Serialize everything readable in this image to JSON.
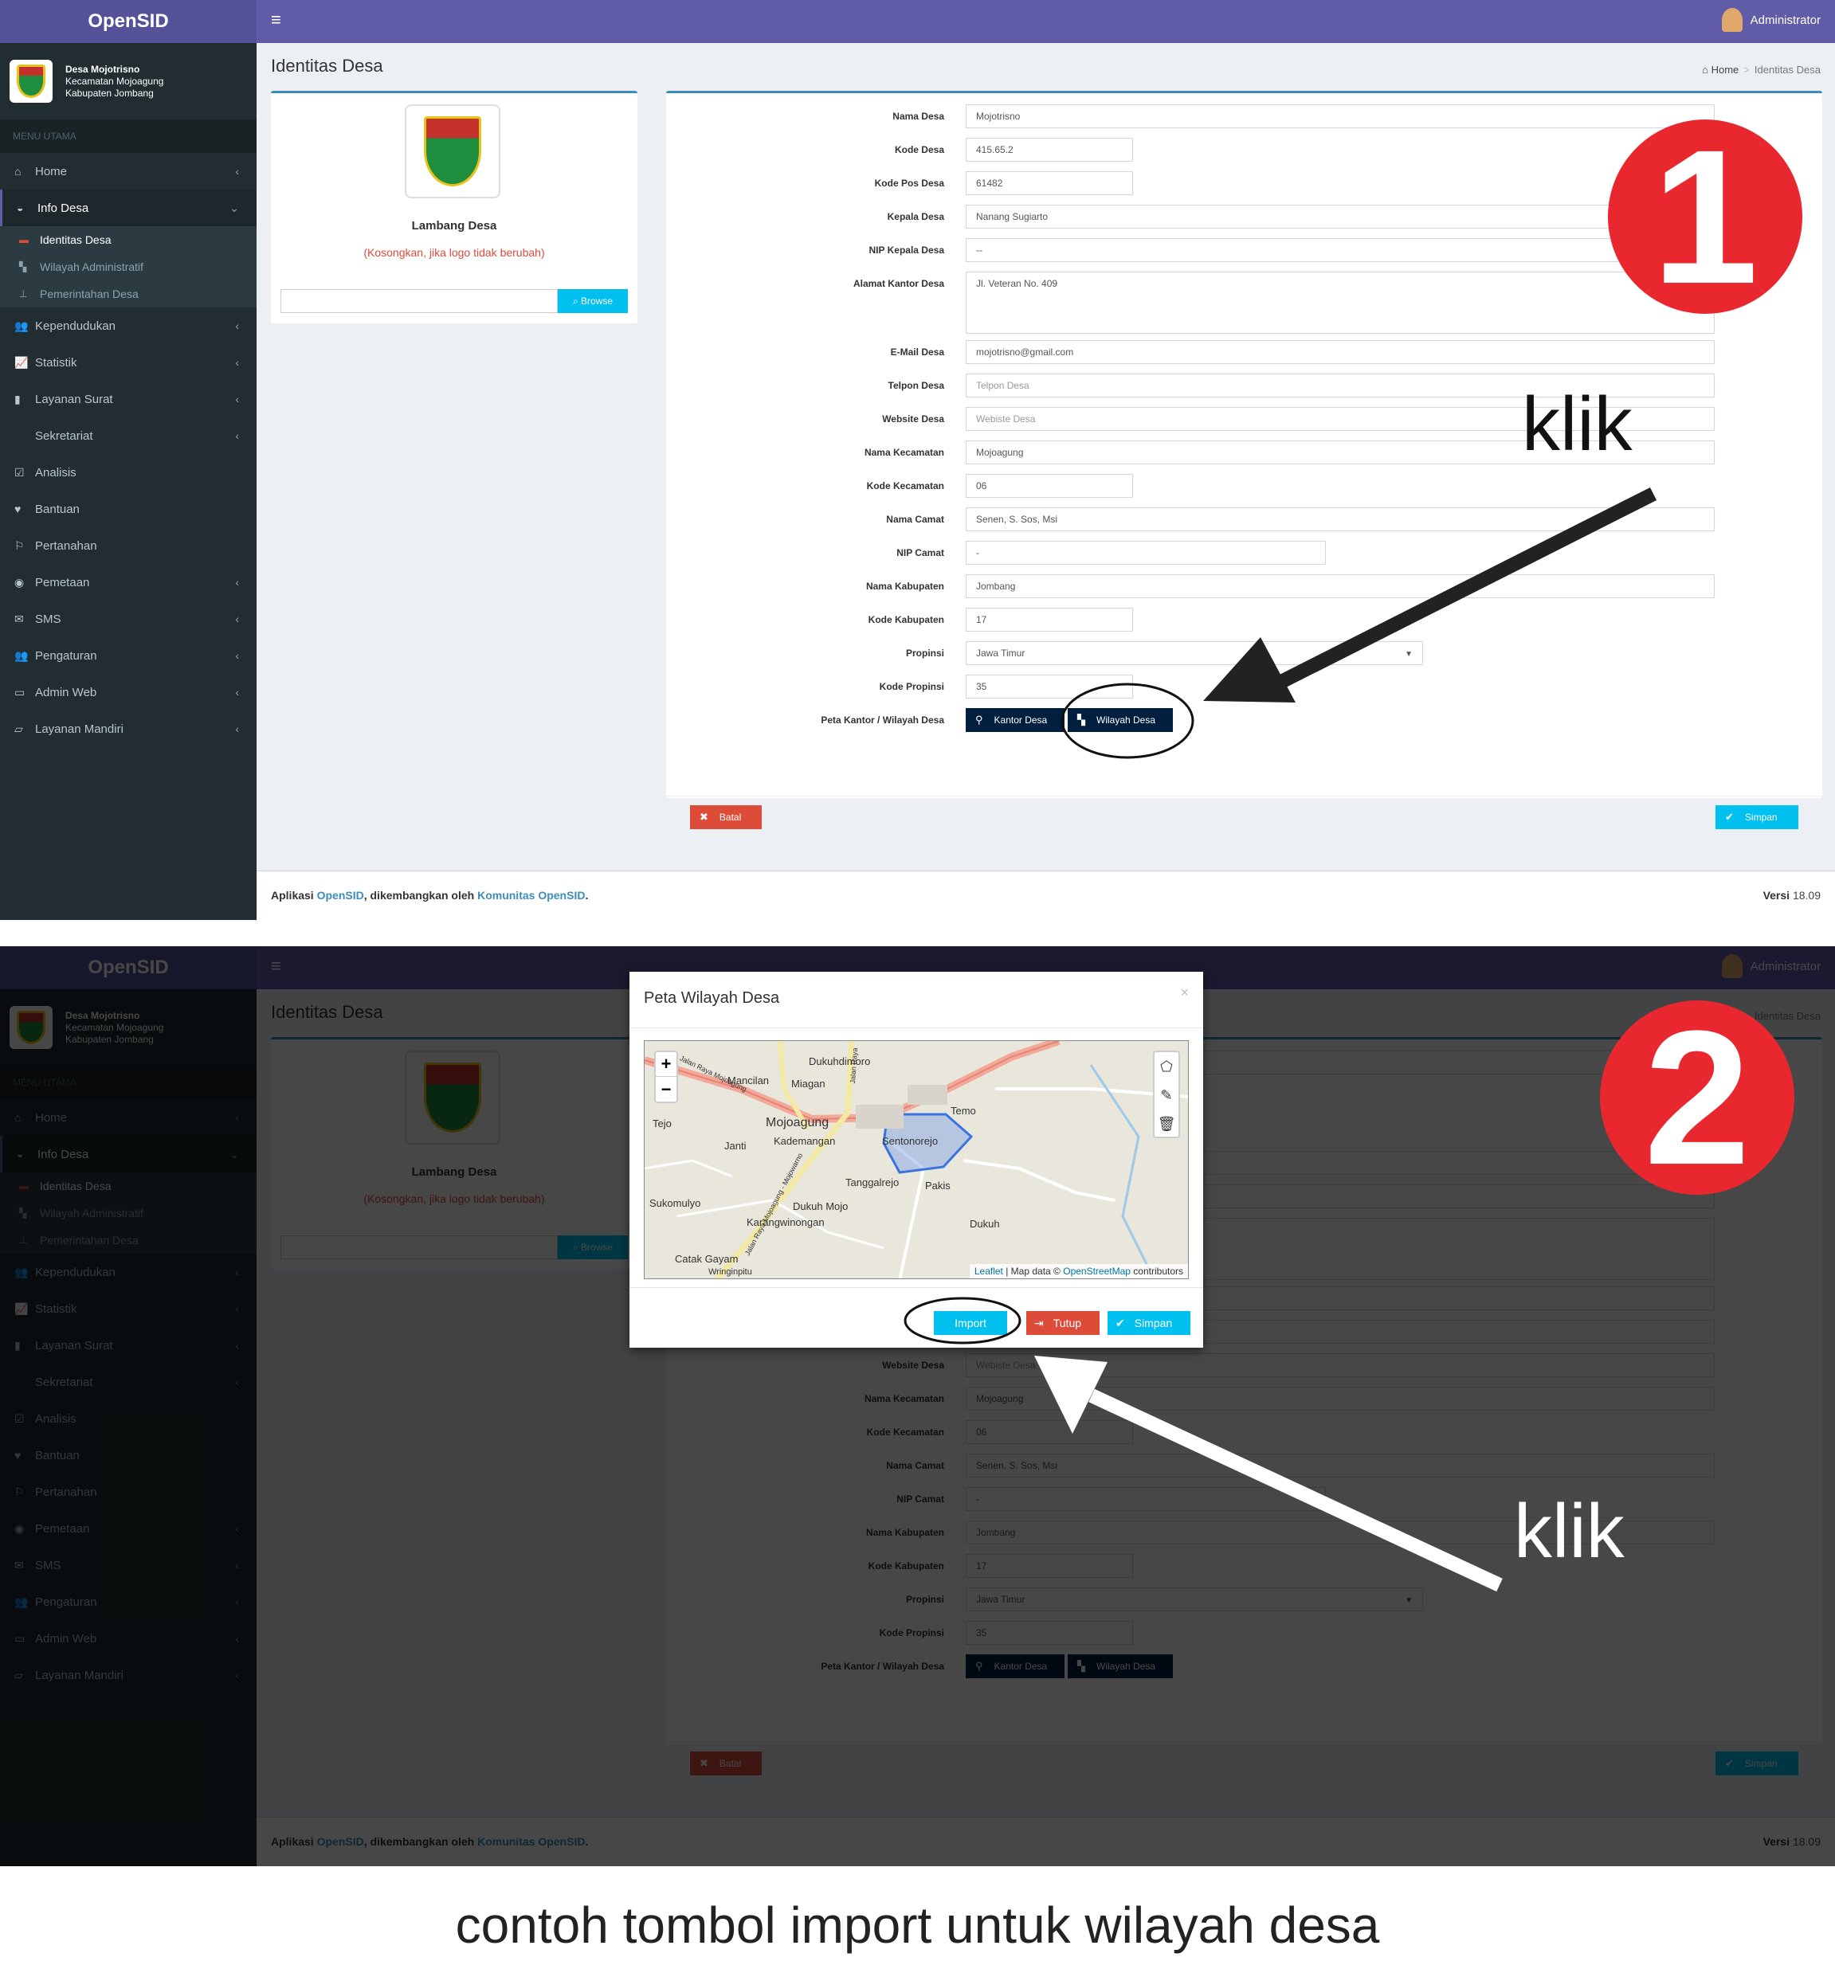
{
  "app": {
    "brand": "OpenSID",
    "user": "Administrator",
    "hamburger": "≡"
  },
  "village": {
    "name": "Desa Mojotrisno",
    "district": "Kecamatan Mojoagung",
    "regency": "Kabupaten Jombang"
  },
  "sidebar": {
    "header": "MENU UTAMA",
    "items": [
      {
        "label": "Home",
        "icon": "home-icon",
        "glyph": "⌂",
        "chevron": "‹"
      },
      {
        "label": "Info Desa",
        "icon": "dashboard-icon",
        "glyph": "◒",
        "chevron": "⌄"
      },
      {
        "label": "Kependudukan",
        "icon": "users-icon",
        "glyph": "👥",
        "chevron": "‹"
      },
      {
        "label": "Statistik",
        "icon": "line-chart-icon",
        "glyph": "📈",
        "chevron": "‹"
      },
      {
        "label": "Layanan Surat",
        "icon": "book-icon",
        "glyph": "▮",
        "chevron": "‹"
      },
      {
        "label": "Sekretariat",
        "icon": "",
        "glyph": "",
        "chevron": "‹"
      },
      {
        "label": "Analisis",
        "icon": "check-square-icon",
        "glyph": "☑",
        "chevron": ""
      },
      {
        "label": "Bantuan",
        "icon": "heart-icon",
        "glyph": "♥",
        "chevron": ""
      },
      {
        "label": "Pertanahan",
        "icon": "road-sign-icon",
        "glyph": "⚐",
        "chevron": ""
      },
      {
        "label": "Pemetaan",
        "icon": "globe-icon",
        "glyph": "◉",
        "chevron": "‹"
      },
      {
        "label": "SMS",
        "icon": "envelope-icon",
        "glyph": "✉",
        "chevron": "‹"
      },
      {
        "label": "Pengaturan",
        "icon": "users-cog-icon",
        "glyph": "👥",
        "chevron": "‹"
      },
      {
        "label": "Admin Web",
        "icon": "desktop-icon",
        "glyph": "▭",
        "chevron": "‹"
      },
      {
        "label": "Layanan Mandiri",
        "icon": "inbox-icon",
        "glyph": "▱",
        "chevron": "‹"
      }
    ],
    "submenu": [
      {
        "label": "Identitas Desa",
        "icon": "id-card-icon",
        "glyph": "▬"
      },
      {
        "label": "Wilayah Administratif",
        "icon": "map-icon",
        "glyph": "▚"
      },
      {
        "label": "Pemerintahan Desa",
        "icon": "sitemap-icon",
        "glyph": "⊥"
      }
    ]
  },
  "page": {
    "title": "Identitas Desa",
    "breadcrumb_home": "Home",
    "breadcrumb_current": "Identitas Desa"
  },
  "logo_box": {
    "label": "Lambang Desa",
    "note": "(Kosongkan, jika logo tidak berubah)",
    "browse": "Browse"
  },
  "form": {
    "fields": [
      {
        "label": "Nama Desa",
        "value": "Mojotrisno"
      },
      {
        "label": "Kode Desa",
        "value": "415.65.2"
      },
      {
        "label": "Kode Pos Desa",
        "value": "61482"
      },
      {
        "label": "Kepala Desa",
        "value": "Nanang Sugiarto"
      },
      {
        "label": "NIP Kepala Desa",
        "value": "--"
      },
      {
        "label": "Alamat Kantor Desa",
        "value": "Jl. Veteran No. 409"
      },
      {
        "label": "E-Mail Desa",
        "value": "mojotrisno@gmail.com"
      },
      {
        "label": "Telpon Desa",
        "value": "",
        "placeholder": "Telpon Desa"
      },
      {
        "label": "Website Desa",
        "value": "",
        "placeholder": "Webiste Desa"
      },
      {
        "label": "Nama Kecamatan",
        "value": "Mojoagung"
      },
      {
        "label": "Kode Kecamatan",
        "value": "06"
      },
      {
        "label": "Nama Camat",
        "value": "Senen, S. Sos, Msi"
      },
      {
        "label": "NIP Camat",
        "value": "-"
      },
      {
        "label": "Nama Kabupaten",
        "value": "Jombang"
      },
      {
        "label": "Kode Kabupaten",
        "value": "17"
      },
      {
        "label": "Propinsi",
        "value": "Jawa Timur"
      },
      {
        "label": "Kode Propinsi",
        "value": "35"
      }
    ],
    "map_label": "Peta Kantor / Wilayah Desa",
    "btn_kantor": "Kantor Desa",
    "btn_wilayah": "Wilayah Desa",
    "btn_batal": "Batal",
    "btn_simpan": "Simpan"
  },
  "footer": {
    "prefix": "Aplikasi",
    "app_link": "OpenSID",
    "middle": ", dikembangkan oleh",
    "community_link": "Komunitas OpenSID",
    "end": ".",
    "version_label": "Versi",
    "version": "18.09"
  },
  "modal": {
    "title": "Peta Wilayah Desa",
    "close": "×",
    "btn_import": "Import",
    "btn_tutup": "Tutup",
    "btn_simpan": "Simpan",
    "zoom_in": "+",
    "zoom_out": "−",
    "attribution_leaflet": "Leaflet",
    "attribution_text": "| Map data ©",
    "attribution_osm": "OpenStreetMap",
    "attribution_end": "contributors",
    "places": [
      "Dukuhdimoro",
      "Mancilan",
      "Miagan",
      "Mojoagung",
      "Kademangan",
      "Tejo",
      "Janti",
      "Sentonorejo",
      "Temo",
      "Tanggalrejo",
      "Pakis",
      "Sukomulyo",
      "Dukuh Mojo",
      "Karangwinongan",
      "Catak Gayam",
      "Dukuh",
      "Wringinpitu",
      "Jalan Raya Mojoagung",
      "Jalan Raya Mojoagung - Mojowarno",
      "Jalan Raya"
    ]
  },
  "annotations": {
    "step1": "1",
    "step2": "2",
    "klik1": "klik",
    "klik2": "klik",
    "caption": "contoh tombol import untuk wilayah desa"
  },
  "colors": {
    "header": "#605ca8",
    "sidebar": "#222d32",
    "primary_blue": "#3c8dbc",
    "info": "#00c0ef",
    "danger": "#dd4b39",
    "navy": "#001f3f",
    "badge_red": "#e8282e"
  }
}
